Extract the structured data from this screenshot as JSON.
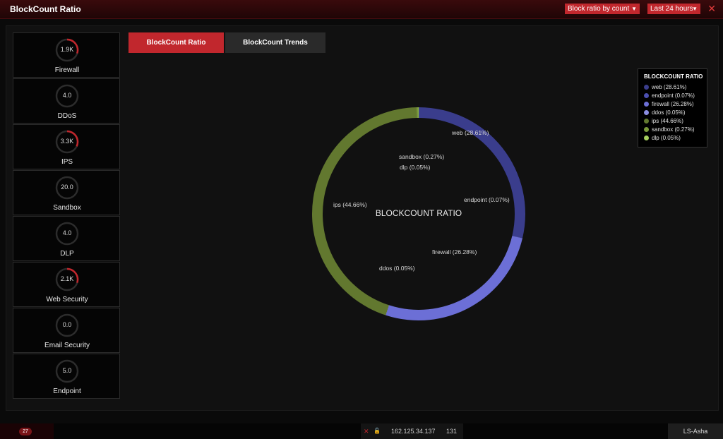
{
  "window": {
    "title": "BlockCount Ratio",
    "ratio_select": "Block ratio by count",
    "time_select": "Last 24 hours",
    "close_icon": "close-icon"
  },
  "sidebar": {
    "cards": [
      {
        "value": "1.9K",
        "label": "Firewall",
        "gauge": 0.3
      },
      {
        "value": "4.0",
        "label": "DDoS",
        "gauge": 0
      },
      {
        "value": "3.3K",
        "label": "IPS",
        "gauge": 0.32
      },
      {
        "value": "20.0",
        "label": "Sandbox",
        "gauge": 0
      },
      {
        "value": "4.0",
        "label": "DLP",
        "gauge": 0
      },
      {
        "value": "2.1K",
        "label": "Web Security",
        "gauge": 0.3
      },
      {
        "value": "0.0",
        "label": "Email Security",
        "gauge": 0
      },
      {
        "value": "5.0",
        "label": "Endpoint",
        "gauge": 0
      }
    ]
  },
  "tabs": [
    {
      "label": "BlockCount Ratio",
      "active": true
    },
    {
      "label": "BlockCount Trends",
      "active": false
    }
  ],
  "chart_data": {
    "type": "pie",
    "title": "BLOCKCOUNT RATIO",
    "slices": [
      {
        "name": "web",
        "label": "web (28.61%)",
        "value": 28.61,
        "color": "#3a3d8c"
      },
      {
        "name": "endpoint",
        "label": "endpoint (0.07%)",
        "value": 0.07,
        "color": "#4b4fb0"
      },
      {
        "name": "firewall",
        "label": "firewall (26.28%)",
        "value": 26.28,
        "color": "#6c6fd6"
      },
      {
        "name": "ddos",
        "label": "ddos (0.05%)",
        "value": 0.05,
        "color": "#8a8de0"
      },
      {
        "name": "ips",
        "label": "ips (44.66%)",
        "value": 44.66,
        "color": "#62782f"
      },
      {
        "name": "sandbox",
        "label": "sandbox (0.27%)",
        "value": 0.27,
        "color": "#7a9a3a"
      },
      {
        "name": "dlp",
        "label": "dlp (0.05%)",
        "value": 0.05,
        "color": "#a6cf5e"
      }
    ],
    "legend": {
      "title": "BLOCKCOUNT RATIO",
      "position": "top-right"
    }
  },
  "statusbar": {
    "badge": "27",
    "ip": "162.125.34.137",
    "count": "131",
    "user": "LS-Asha"
  },
  "colors": {
    "accent": "#c1272d",
    "background": "#0a0a0a"
  }
}
